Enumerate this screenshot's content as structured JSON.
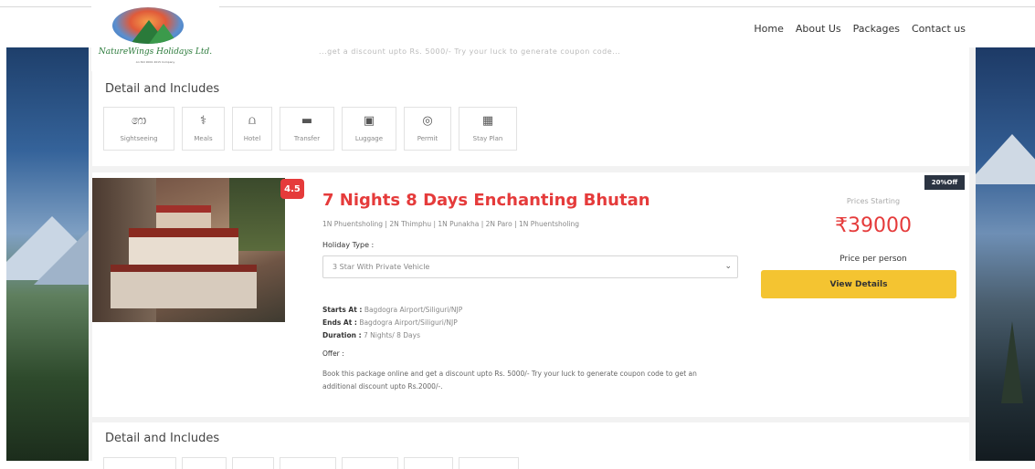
{
  "brand": {
    "name": "NatureWings Holidays Ltd.",
    "tagline": "An ISO 9001 2015 Company"
  },
  "nav": [
    "Home",
    "About Us",
    "Packages",
    "Contact us"
  ],
  "top_card": {
    "faded_text": "...get a discount upto Rs. 5000/- Try your luck to generate coupon code...",
    "detail_title": "Detail and Includes"
  },
  "includes": [
    {
      "label": "Sightseeing",
      "icon": "binoculars-icon"
    },
    {
      "label": "Meals",
      "icon": "meals-icon"
    },
    {
      "label": "Hotel",
      "icon": "bed-icon"
    },
    {
      "label": "Transfer",
      "icon": "car-icon"
    },
    {
      "label": "Luggage",
      "icon": "luggage-icon"
    },
    {
      "label": "Permit",
      "icon": "map-pin-icon"
    },
    {
      "label": "Stay Plan",
      "icon": "calendar-icon"
    }
  ],
  "package": {
    "rating": "4.5",
    "discount": "20%Off",
    "title": "7 Nights 8 Days Enchanting Bhutan",
    "route": "1N Phuentsholing | 2N Thimphu | 1N Punakha | 2N Paro | 1N Phuentsholing",
    "holiday_type_label": "Holiday Type :",
    "holiday_type_value": "3 Star With Private Vehicle",
    "starts_label": "Starts At :",
    "starts_value": "Bagdogra Airport/Siliguri/NJP",
    "ends_label": "Ends At :",
    "ends_value": "Bagdogra Airport/Siliguri/NJP",
    "duration_label": "Duration :",
    "duration_value": "7 Nights/ 8 Days",
    "offer_label": "Offer :",
    "offer_text": "Book this package online and get a discount upto Rs. 5000/- Try your luck to generate coupon code to get an additional discount upto Rs.2000/-.",
    "prices_starting": "Prices Starting",
    "price": "₹39000",
    "price_per": "Price per person",
    "view_details": "View Details"
  },
  "bottom_card": {
    "detail_title": "Detail and Includes"
  },
  "colors": {
    "accent": "#e53b3b",
    "button": "#f4c431",
    "badge": "#2b3442"
  }
}
